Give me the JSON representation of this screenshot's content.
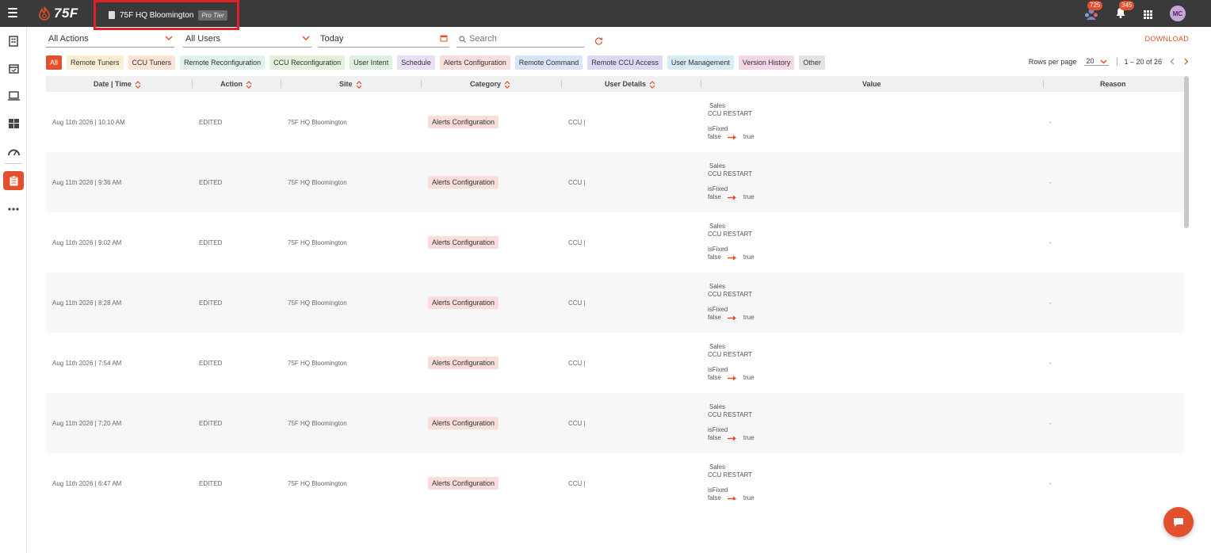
{
  "header": {
    "logo_text": "75F",
    "site_name": "75F HQ Bloomington",
    "tier": "Pro Tier",
    "notifications_count_1": "725",
    "notifications_count_2": "345",
    "avatar_initials": "MC"
  },
  "filters": {
    "actions": "All Actions",
    "users": "All Users",
    "date": "Today",
    "search_placeholder": "Search",
    "download": "DOWNLOAD"
  },
  "chips": [
    {
      "label": "All",
      "color": "#e2502d"
    },
    {
      "label": "Remote Tuners",
      "color": "#fbeed5"
    },
    {
      "label": "CCU Tuners",
      "color": "#fbe3d5"
    },
    {
      "label": "Remote Reconfiguration",
      "color": "#dff3ea"
    },
    {
      "label": "CCU Reconfiguration",
      "color": "#e3f1dc"
    },
    {
      "label": "User Intent",
      "color": "#def0df"
    },
    {
      "label": "Schedule",
      "color": "#eadff7"
    },
    {
      "label": "Alerts Configuration",
      "color": "#f8dede"
    },
    {
      "label": "Remote Command",
      "color": "#d9e4f7"
    },
    {
      "label": "Remote CCU Access",
      "color": "#dcd9f5"
    },
    {
      "label": "User Management",
      "color": "#d7ecf5"
    },
    {
      "label": "Version History",
      "color": "#f4d6e6"
    },
    {
      "label": "Other",
      "color": "#e3e3e3"
    }
  ],
  "pager": {
    "rows_label": "Rows per page",
    "rows_value": "20",
    "range": "1 – 20 of 26"
  },
  "columns": [
    "Date | Time",
    "Action",
    "Site",
    "Category",
    "User Details",
    "Value",
    "Reason"
  ],
  "rows": [
    {
      "date": "Aug 11th 2026 | 10:10 AM",
      "action": "EDITED",
      "site": "75F HQ Bloomington",
      "category": "Alerts Configuration",
      "user": "CCU |",
      "v1": "Sales",
      "v2": "CCU RESTART",
      "v3": "isFixed",
      "from": "false",
      "to": "true",
      "reason": "-"
    },
    {
      "date": "Aug 11th 2026 | 9:36 AM",
      "action": "EDITED",
      "site": "75F HQ Bloomington",
      "category": "Alerts Configuration",
      "user": "CCU |",
      "v1": "Sales",
      "v2": "CCU RESTART",
      "v3": "isFixed",
      "from": "false",
      "to": "true",
      "reason": "-"
    },
    {
      "date": "Aug 11th 2026 | 9:02 AM",
      "action": "EDITED",
      "site": "75F HQ Bloomington",
      "category": "Alerts Configuration",
      "user": "CCU |",
      "v1": "Sales",
      "v2": "CCU RESTART",
      "v3": "isFixed",
      "from": "false",
      "to": "true",
      "reason": "-"
    },
    {
      "date": "Aug 11th 2026 | 8:28 AM",
      "action": "EDITED",
      "site": "75F HQ Bloomington",
      "category": "Alerts Configuration",
      "user": "CCU |",
      "v1": "Sales",
      "v2": "CCU RESTART",
      "v3": "isFixed",
      "from": "false",
      "to": "true",
      "reason": "-"
    },
    {
      "date": "Aug 11th 2026 | 7:54 AM",
      "action": "EDITED",
      "site": "75F HQ Bloomington",
      "category": "Alerts Configuration",
      "user": "CCU |",
      "v1": "Sales",
      "v2": "CCU RESTART",
      "v3": "isFixed",
      "from": "false",
      "to": "true",
      "reason": "-"
    },
    {
      "date": "Aug 11th 2026 | 7:20 AM",
      "action": "EDITED",
      "site": "75F HQ Bloomington",
      "category": "Alerts Configuration",
      "user": "CCU |",
      "v1": "Sales",
      "v2": "CCU RESTART",
      "v3": "isFixed",
      "from": "false",
      "to": "true",
      "reason": "-"
    },
    {
      "date": "Aug 11th 2026 | 6:47 AM",
      "action": "EDITED",
      "site": "75F HQ Bloomington",
      "category": "Alerts Configuration",
      "user": "CCU |",
      "v1": "Sales",
      "v2": "CCU RESTART",
      "v3": "isFixed",
      "from": "false",
      "to": "true",
      "reason": "-"
    }
  ],
  "colors": {
    "accent": "#e2502d",
    "topbar": "#3a3a3a"
  }
}
